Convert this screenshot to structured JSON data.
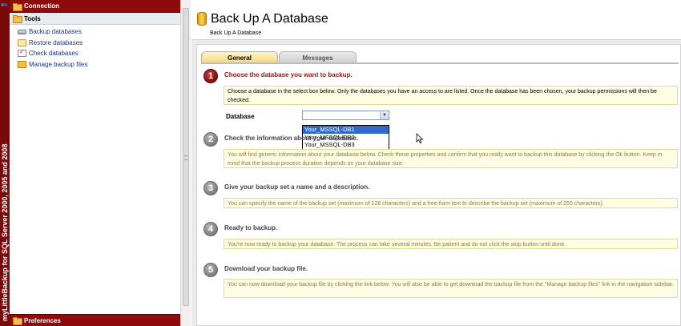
{
  "brand": {
    "text": "myLittleBackup for SQL Server 2000, 2005 and 2008"
  },
  "nav": {
    "connection_label": "Connection",
    "tools_label": "Tools",
    "items": [
      {
        "label": "Backup databases",
        "icon": "drive-icon"
      },
      {
        "label": "Restore databases",
        "icon": "restore-icon"
      },
      {
        "label": "Check databases",
        "icon": "checklist-icon"
      },
      {
        "label": "Manage backup files",
        "icon": "files-icon"
      }
    ],
    "preferences_label": "Preferences"
  },
  "header": {
    "title": "Back Up A Database",
    "breadcrumb": "Back Up A Database"
  },
  "tabs": [
    {
      "label": "General",
      "active": true
    },
    {
      "label": "Messages",
      "active": false
    }
  ],
  "steps": [
    {
      "number": "1",
      "title": "Choose the database you want to backup.",
      "description": "Choose a database in the select box below. Only the databases you have an access to are listed. Once the database has been chosen, your backup permissions will then be checked.",
      "active": true
    },
    {
      "number": "2",
      "title": "Check the information about your database.",
      "description": "You will find generic information about your database below. Check these properties and confirm that you really want to backup this database by clicking the Ok button. Keep in mind that the backup process duration depends on your database size.",
      "active": false
    },
    {
      "number": "3",
      "title": "Give your backup set a name and a description.",
      "description": "You can specify the name of the backup set (maximum of 128 characters) and a free-form text to describe the backup set (maximum of 255 characters).",
      "active": false
    },
    {
      "number": "4",
      "title": "Ready to backup.",
      "description": "You're now ready to backup your database. The process can take several minutes. Be patient and do not click the stop button until done.",
      "active": false
    },
    {
      "number": "5",
      "title": "Download your backup file.",
      "description": "You can now download your backup file by clicking the link below. You will also be able to get download the backup file from the \"Manage backup files\" link in the navigation sidebar.",
      "active": false
    }
  ],
  "database": {
    "label": "Database",
    "selected": "",
    "options": [
      "Your_MSSQL-DB1",
      "Your_MSSQL-DB2",
      "Your_MSSQL-DB3"
    ],
    "highlighted": "Your_MSSQL-DB1"
  },
  "colors": {
    "brand_red": "#8d0b0b",
    "step_active_red": "#9a1212",
    "desc_background": "#fffde4",
    "tab_active": "#f7d77a",
    "selection_blue": "#316ac5"
  }
}
